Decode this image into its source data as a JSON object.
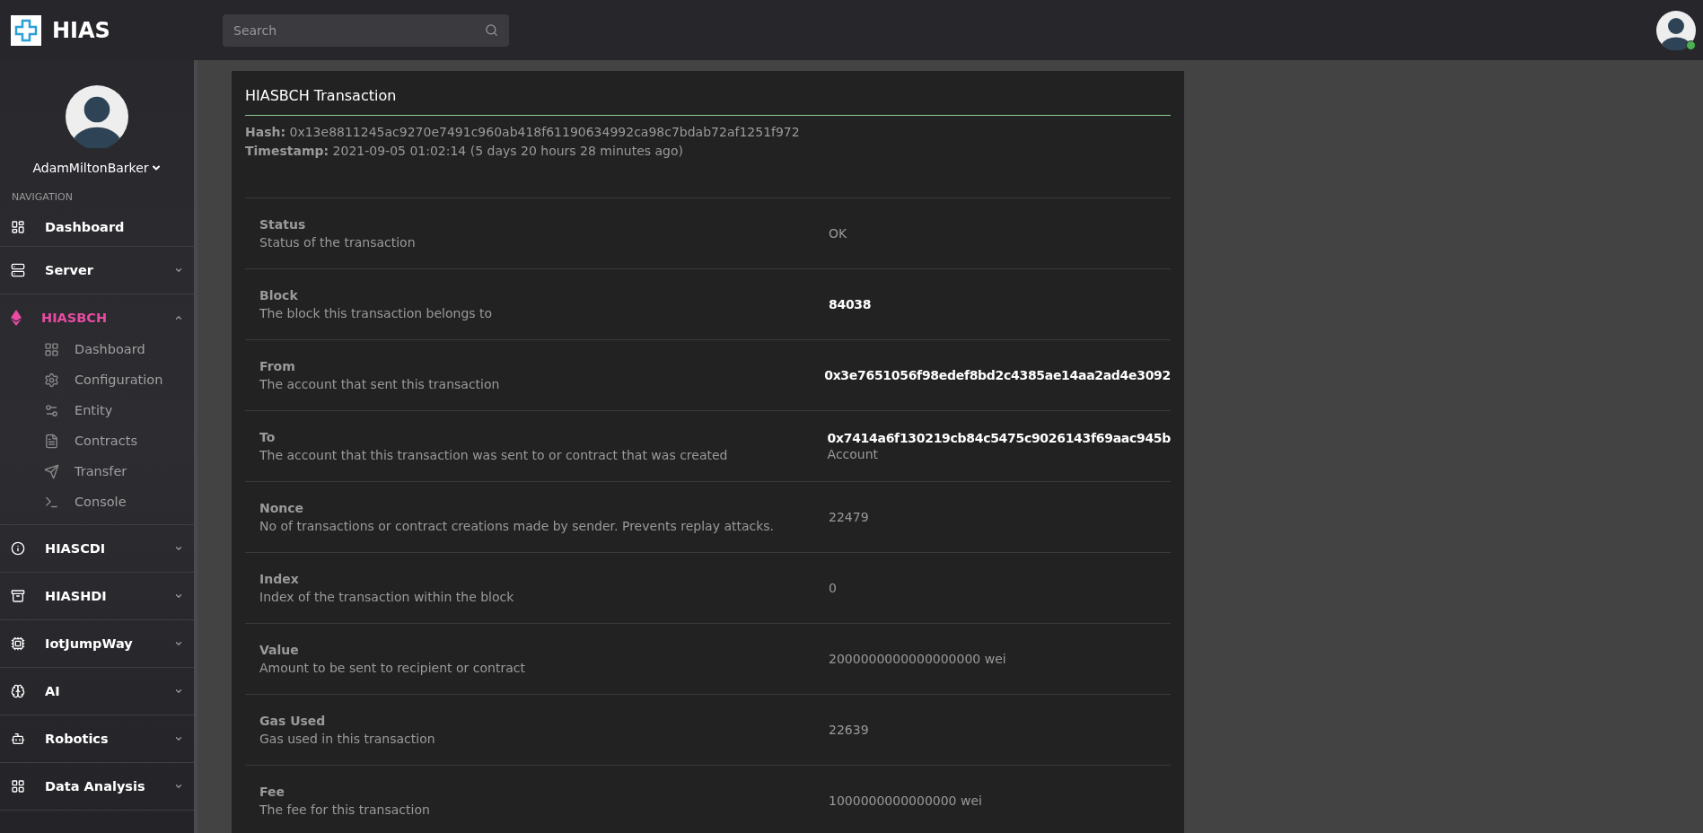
{
  "topbar": {
    "brand": "HIAS",
    "search": {
      "placeholder": "Search"
    },
    "user_online": true
  },
  "sidebar": {
    "user": {
      "name": "AdamMiltonBarker"
    },
    "section_label": "NAVIGATION",
    "items": [
      {
        "label": "Dashboard",
        "kind": "link",
        "selected": false
      },
      {
        "label": "Server",
        "kind": "menu",
        "selected": false,
        "expanded": false
      },
      {
        "label": "HIASBCH",
        "kind": "menu",
        "selected": true,
        "expanded": true,
        "children": [
          {
            "label": "Dashboard"
          },
          {
            "label": "Configuration"
          },
          {
            "label": "Entity"
          },
          {
            "label": "Contracts"
          },
          {
            "label": "Transfer"
          },
          {
            "label": "Console"
          }
        ]
      },
      {
        "label": "HIASCDI",
        "kind": "menu",
        "selected": false,
        "expanded": false
      },
      {
        "label": "HIASHDI",
        "kind": "menu",
        "selected": false,
        "expanded": false
      },
      {
        "label": "IotJumpWay",
        "kind": "menu",
        "selected": false,
        "expanded": false
      },
      {
        "label": "AI",
        "kind": "menu",
        "selected": false,
        "expanded": false
      },
      {
        "label": "Robotics",
        "kind": "menu",
        "selected": false,
        "expanded": false
      },
      {
        "label": "Data Analysis",
        "kind": "menu",
        "selected": false,
        "expanded": false
      }
    ]
  },
  "card": {
    "title": "HIASBCH Transaction",
    "meta": [
      {
        "label": "Hash:",
        "value": "0x13e8811245ac9270e7491c960ab418f61190634992ca98c7bdab72af1251f972"
      },
      {
        "label": "Timestamp:",
        "value": "2021-09-05 01:02:14 (5 days 20 hours 28 minutes ago)"
      }
    ],
    "rows": [
      {
        "label": "Status",
        "description": "Status of the transaction",
        "value": "OK",
        "kind": "plain"
      },
      {
        "label": "Block",
        "description": "The block this transaction belongs to",
        "value": "84038",
        "kind": "link"
      },
      {
        "label": "From",
        "description": "The account that sent this transaction",
        "value": "0x3e7651056f98edef8bd2c4385ae14aa2ad4e3092",
        "kind": "link"
      },
      {
        "label": "To",
        "description": "The account that this transaction was sent to or contract that was created",
        "value": "0x7414a6f130219cb84c5475c9026143f69aac945b",
        "note": "Account",
        "kind": "link"
      },
      {
        "label": "Nonce",
        "description": "No of transactions or contract creations made by sender. Prevents replay attacks.",
        "value": "22479",
        "kind": "plain"
      },
      {
        "label": "Index",
        "description": "Index of the transaction within the block",
        "value": "0",
        "kind": "plain"
      },
      {
        "label": "Value",
        "description": "Amount to be sent to recipient or contract",
        "value": "2000000000000000000 wei",
        "kind": "plain"
      },
      {
        "label": "Gas Used",
        "description": "Gas used in this transaction",
        "value": "22639",
        "kind": "plain"
      },
      {
        "label": "Fee",
        "description": "The fee for this transaction",
        "value": "1000000000000000 wei",
        "kind": "plain"
      }
    ]
  }
}
